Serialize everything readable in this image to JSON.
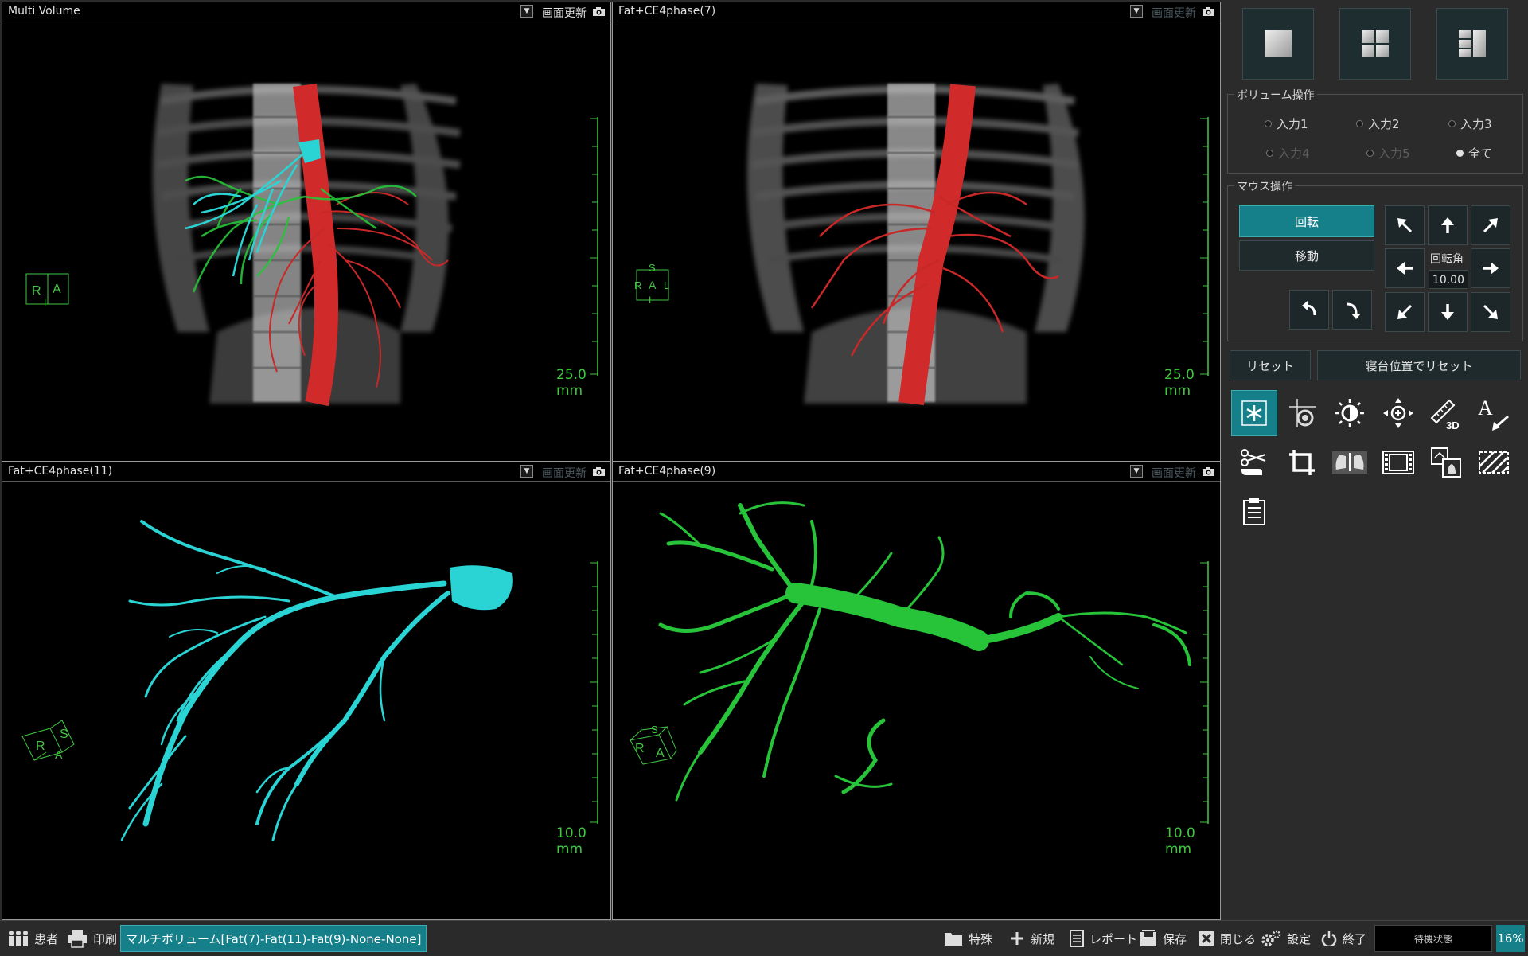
{
  "viewports": [
    {
      "title": "Multi Volume",
      "refresh": "画面更新",
      "scale": "25.0 mm",
      "orient": [
        "R",
        "A",
        "I"
      ]
    },
    {
      "title": "Fat+CE4phase(7)",
      "refresh": "画面更新",
      "scale": "25.0 mm",
      "orient": [
        "S",
        "R",
        "A",
        "L",
        "I"
      ]
    },
    {
      "title": "Fat+CE4phase(11)",
      "refresh": "画面更新",
      "scale": "10.0 mm",
      "orient": [
        "R",
        "S",
        "A"
      ]
    },
    {
      "title": "Fat+CE4phase(9)",
      "refresh": "画面更新",
      "scale": "10.0 mm",
      "orient": [
        "R",
        "S",
        "A"
      ]
    }
  ],
  "panel": {
    "volume_group": {
      "legend": "ボリューム操作",
      "radios": [
        {
          "label": "入力1",
          "selected": false,
          "enabled": true
        },
        {
          "label": "入力2",
          "selected": false,
          "enabled": true
        },
        {
          "label": "入力3",
          "selected": false,
          "enabled": true
        },
        {
          "label": "入力4",
          "selected": false,
          "enabled": false
        },
        {
          "label": "入力5",
          "selected": false,
          "enabled": false
        },
        {
          "label": "全て",
          "selected": true,
          "enabled": true
        }
      ]
    },
    "mouse_group": {
      "legend": "マウス操作",
      "rotate": "回転",
      "move": "移動",
      "angle_label": "回転角",
      "angle_value": "10.00"
    },
    "reset": "リセット",
    "reset_bed": "寝台位置でリセット"
  },
  "taskbar": {
    "patient": "患者",
    "print": "印刷",
    "active_task": "マルチボリューム[Fat(7)-Fat(11)-Fat(9)-None-None]",
    "special": "特殊",
    "new": "新規",
    "report": "レポート",
    "save": "保存",
    "close": "閉じる",
    "settings": "設定",
    "exit": "終了",
    "status": "待機状態",
    "zoom": "16%"
  },
  "colors": {
    "accent": "#16808a",
    "scale_green": "#42c742",
    "vessel_red": "#d02a2a",
    "portal_cyan": "#2ad4d4",
    "hepatic_green": "#27c43a"
  }
}
